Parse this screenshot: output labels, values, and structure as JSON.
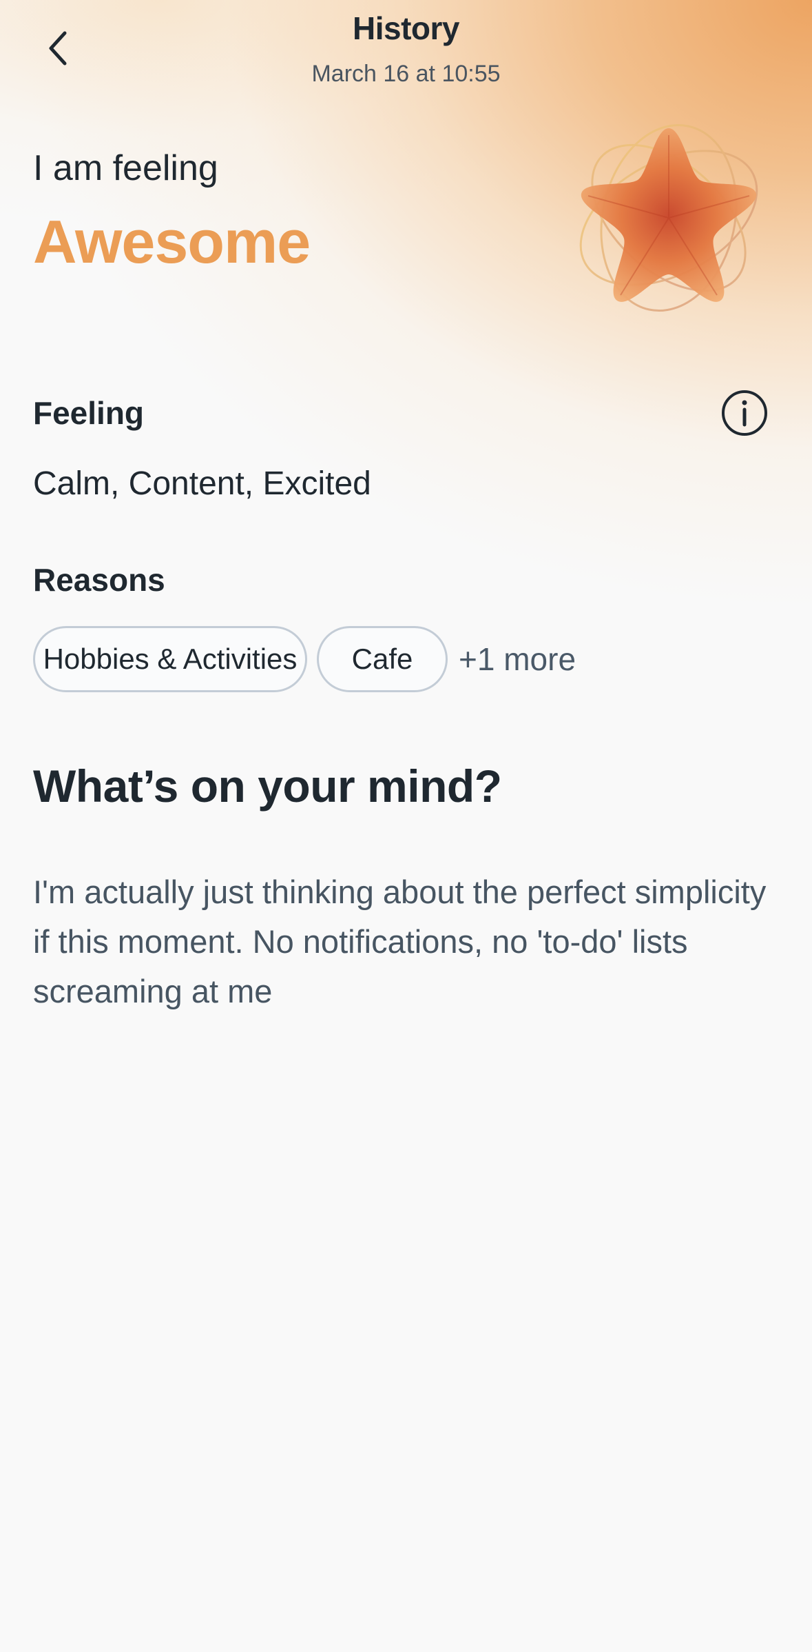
{
  "header": {
    "title": "History",
    "subtitle": "March 16 at 10:55",
    "back_icon": "chevron-left-icon"
  },
  "mood": {
    "prefix": "I am feeling",
    "value": "Awesome",
    "color": "#eb9d55",
    "emblem_icon": "star-flower-icon"
  },
  "feeling": {
    "label": "Feeling",
    "values": "Calm, Content, Excited",
    "info_icon": "info-icon"
  },
  "reasons": {
    "label": "Reasons",
    "chips": [
      "Hobbies & Activities",
      "Cafe"
    ],
    "more": "+1 more"
  },
  "mind": {
    "title": "What’s on your mind?",
    "text": "I'm actually just thinking about the perfect simplicity if this moment. No notifications, no 'to-do' lists screaming at me"
  }
}
